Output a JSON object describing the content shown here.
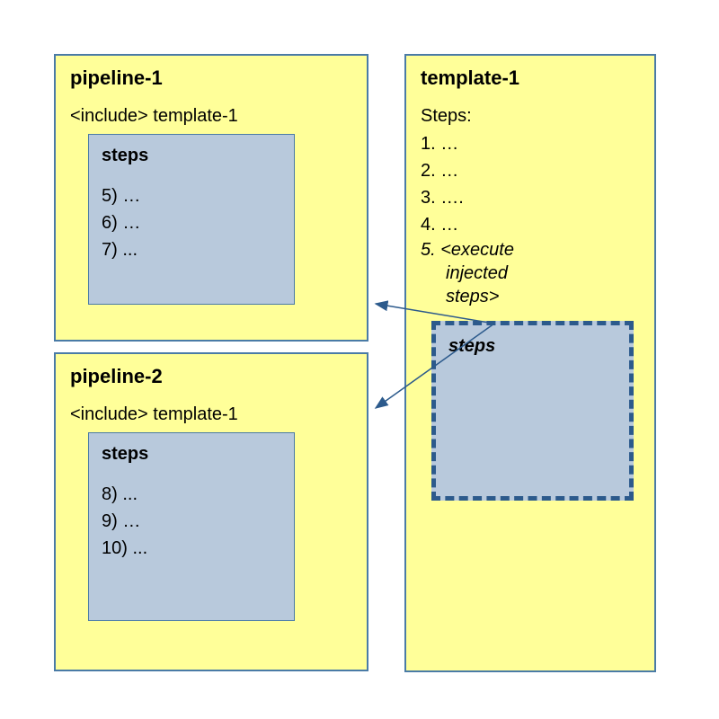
{
  "pipeline1": {
    "title": "pipeline-1",
    "include": "<include> template-1",
    "steps_label": "steps",
    "steps": [
      "5) …",
      "6) …",
      "7) ..."
    ]
  },
  "pipeline2": {
    "title": "pipeline-2",
    "include": "<include> template-1",
    "steps_label": "steps",
    "steps": [
      "8) ...",
      "9) …",
      "10) ..."
    ]
  },
  "template1": {
    "title": "template-1",
    "steps_header": "Steps:",
    "steps": [
      "1. …",
      "2. …",
      "3. ….",
      "4. …"
    ],
    "execute_line1": "5. <execute",
    "execute_line2": "injected",
    "execute_line3": "steps>",
    "placeholder_label": "steps"
  }
}
